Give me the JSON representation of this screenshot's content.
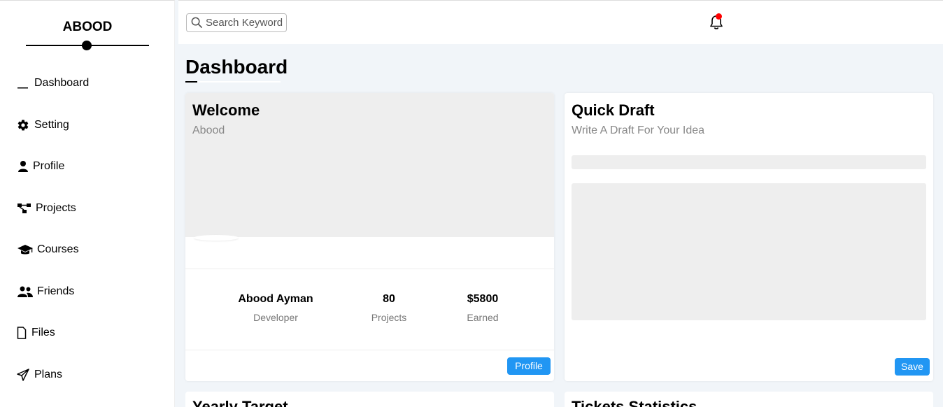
{
  "sidebar": {
    "logo": "ABOOD",
    "items": [
      {
        "label": "Dashboard",
        "icon": "dash-icon"
      },
      {
        "label": "Setting",
        "icon": "gear-icon"
      },
      {
        "label": "Profile",
        "icon": "user-icon"
      },
      {
        "label": "Projects",
        "icon": "diagram-icon"
      },
      {
        "label": "Courses",
        "icon": "graduation-cap-icon"
      },
      {
        "label": "Friends",
        "icon": "users-icon"
      },
      {
        "label": "Files",
        "icon": "file-icon"
      },
      {
        "label": "Plans",
        "icon": "paper-plane-icon"
      }
    ]
  },
  "header": {
    "search_placeholder": "Search Keyword",
    "notification_icon": "bell-icon",
    "notification_dot_color": "#ff0000"
  },
  "page": {
    "title": "Dashboard"
  },
  "welcome": {
    "title": "Welcome",
    "subtitle": "Abood",
    "stats": [
      {
        "value": "Abood Ayman",
        "label": "Developer"
      },
      {
        "value": "80",
        "label": "Projects"
      },
      {
        "value": "$5800",
        "label": "Earned"
      }
    ],
    "button": "Profile"
  },
  "draft": {
    "title": "Quick Draft",
    "subtitle": "Write A Draft For Your Idea",
    "button": "Save"
  },
  "bottom_cards": [
    {
      "title": "Yearly Target"
    },
    {
      "title": "Tickets Statistics"
    }
  ],
  "colors": {
    "accent": "#2196f3",
    "background": "#f1f5f9"
  }
}
